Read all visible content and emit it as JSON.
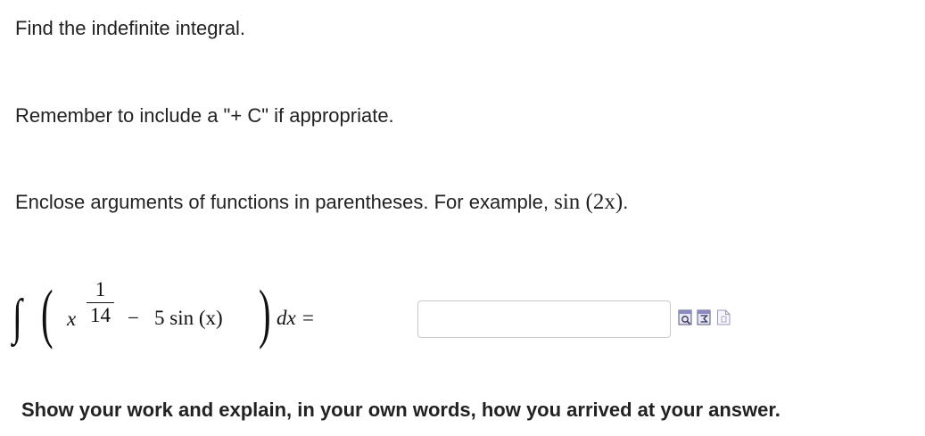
{
  "instructions": {
    "line1": "Find the indefinite integral.",
    "line2": "Remember to include a \"+ C\" if appropriate.",
    "line3_text": "Enclose arguments of functions in parentheses. For example, ",
    "line3_math": "sin (2x)",
    "line3_end": "."
  },
  "integral": {
    "sign": "∫",
    "open_paren": "(",
    "variable": "x",
    "fraction_numerator": "1",
    "fraction_denominator": "14",
    "minus": "−",
    "term": "5 sin (x)",
    "close_paren": ")",
    "differential": "dx =",
    "full_expression": "∫ ( x^(1/14) − 5 sin (x) ) dx ="
  },
  "answer": {
    "value": "",
    "placeholder": ""
  },
  "tools": {
    "preview_icon": "preview-icon",
    "symbols_icon": "symbols-icon",
    "help_icon": "help-icon"
  },
  "footer": {
    "text": "Show your work and explain, in your own words, how you arrived at your answer."
  }
}
